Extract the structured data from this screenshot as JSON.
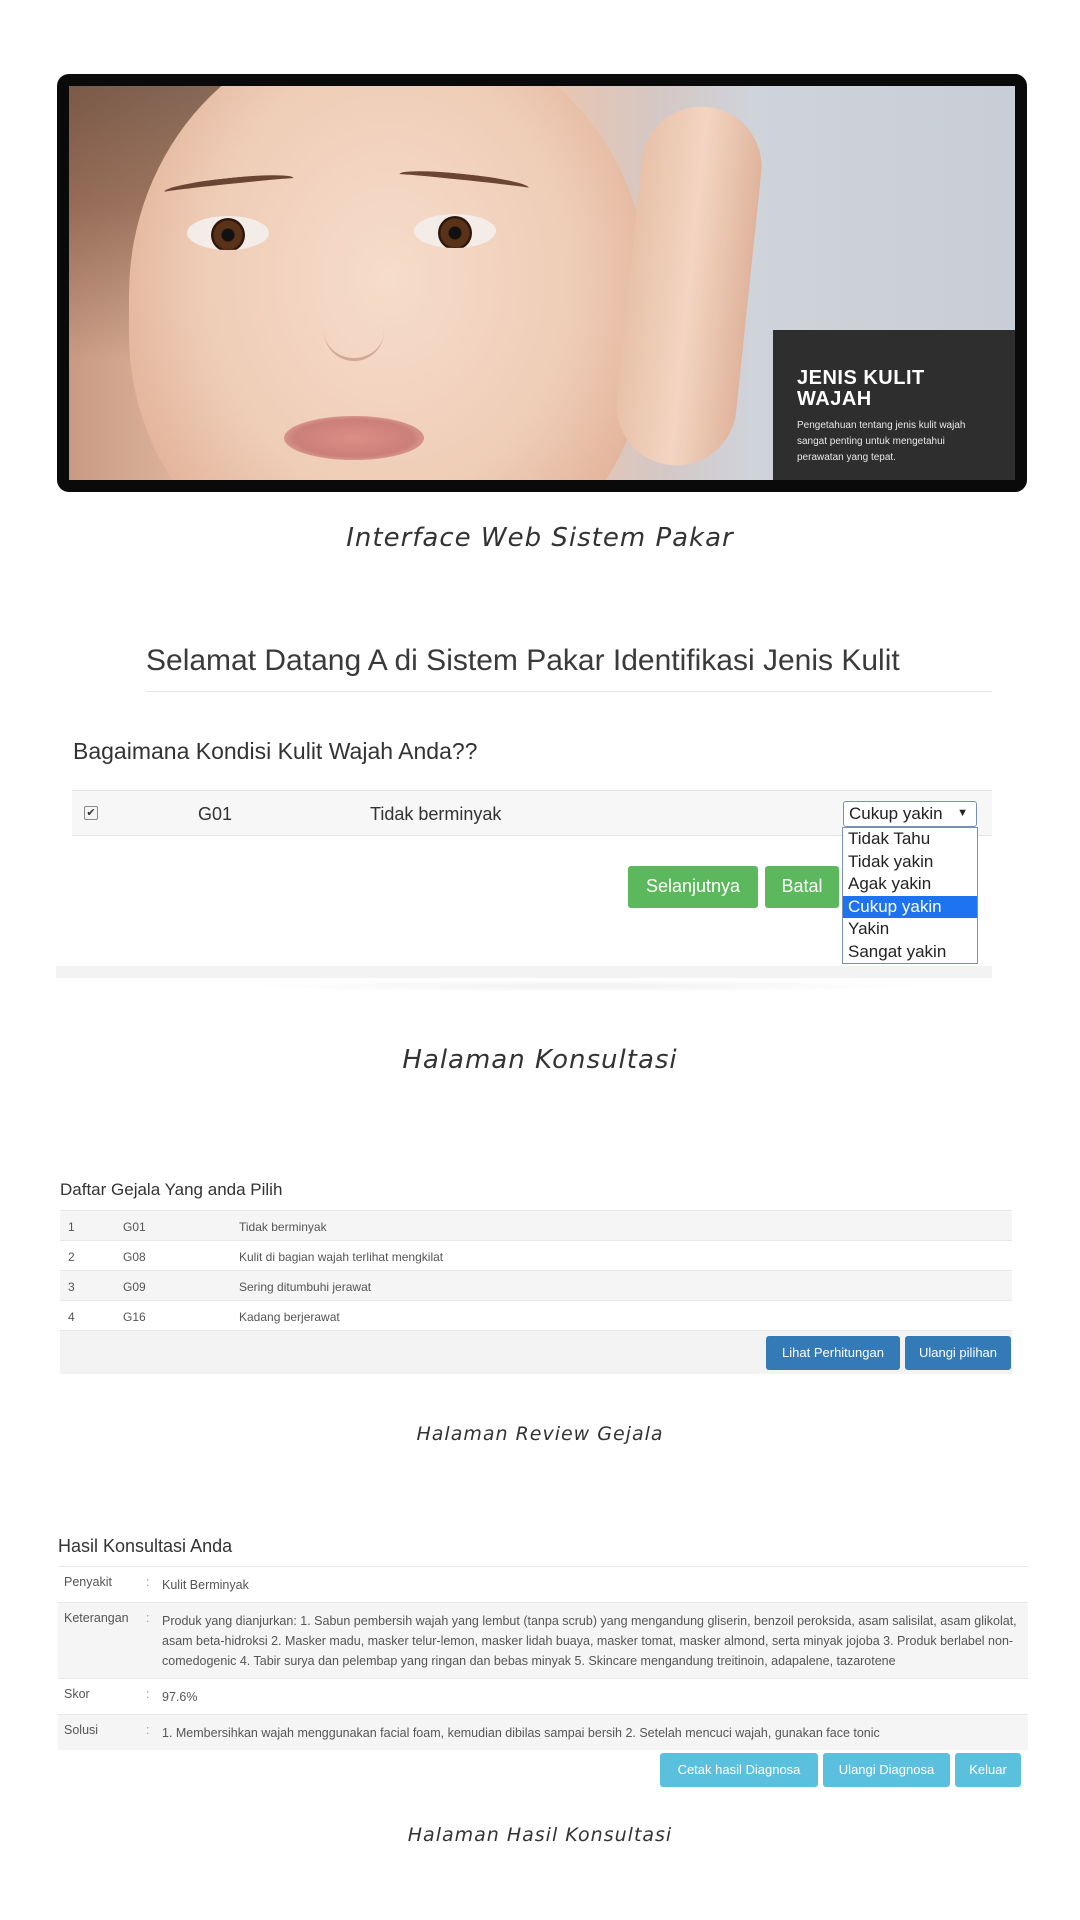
{
  "banner": {
    "title": "JENIS KULIT WAJAH",
    "text": "Pengetahuan tentang jenis kulit wajah sangat penting untuk mengetahui perawatan yang tepat."
  },
  "captions": {
    "banner": "Interface Web Sistem Pakar",
    "konsultasi": "Halaman Konsultasi",
    "review": "Halaman Review Gejala",
    "hasil": "Halaman Hasil Konsultasi"
  },
  "konsultasi": {
    "title": "Selamat Datang A di Sistem Pakar Identifikasi Jenis Kulit",
    "question": "Bagaimana Kondisi Kulit Wajah Anda??",
    "row": {
      "checked": true,
      "code": "G01",
      "description": "Tidak berminyak"
    },
    "select_value": "Cukup yakin",
    "options": [
      "Tidak Tahu",
      "Tidak yakin",
      "Agak yakin",
      "Cukup yakin",
      "Yakin",
      "Sangat yakin"
    ],
    "next_label": "Selanjutnya",
    "cancel_label": "Batal"
  },
  "review": {
    "heading": "Daftar Gejala Yang anda Pilih",
    "rows": [
      {
        "no": "1",
        "code": "G01",
        "description": "Tidak berminyak"
      },
      {
        "no": "2",
        "code": "G08",
        "description": "Kulit di bagian wajah terlihat mengkilat"
      },
      {
        "no": "3",
        "code": "G09",
        "description": "Sering ditumbuhi jerawat"
      },
      {
        "no": "4",
        "code": "G16",
        "description": "Kadang berjerawat"
      }
    ],
    "calc_label": "Lihat Perhitungan",
    "repeat_label": "Ulangi pilihan"
  },
  "hasil": {
    "heading": "Hasil Konsultasi Anda",
    "separator": ":",
    "rows": [
      {
        "label": "Penyakit",
        "value": "Kulit Berminyak"
      },
      {
        "label": "Keterangan",
        "value": "Produk yang dianjurkan: 1. Sabun pembersih wajah yang lembut (tanpa scrub) yang mengandung gliserin, benzoil peroksida, asam salisilat, asam glikolat, asam beta-hidroksi 2. Masker madu, masker telur-lemon, masker lidah buaya, masker tomat, masker almond, serta minyak jojoba 3. Produk berlabel non-comedogenic 4. Tabir surya dan pelembap yang ringan dan bebas minyak 5. Skincare mengandung treitinoin, adapalene, tazarotene"
      },
      {
        "label": "Skor",
        "value": "97.6%"
      },
      {
        "label": "Solusi",
        "value": "1. Membersihkan wajah menggunakan facial foam, kemudian dibilas sampai bersih 2. Setelah mencuci wajah, gunakan face tonic"
      }
    ],
    "print_label": "Cetak hasil Diagnosa",
    "repeat_label": "Ulangi Diagnosa",
    "exit_label": "Keluar"
  },
  "colors": {
    "green": "#5cb85c",
    "blue": "#337ab7",
    "cyan": "#5bc0de",
    "select_highlight": "#1e74f0"
  }
}
